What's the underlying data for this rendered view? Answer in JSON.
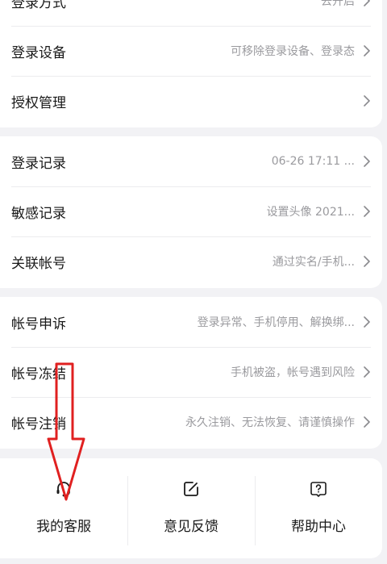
{
  "groups": {
    "top": [
      {
        "label": "登录方式",
        "value": "去开启"
      },
      {
        "label": "登录设备",
        "value": "可移除登录设备、登录态"
      },
      {
        "label": "授权管理",
        "value": ""
      }
    ],
    "mid": [
      {
        "label": "登录记录",
        "value": "06-26 17:11 ..."
      },
      {
        "label": "敏感记录",
        "value": "设置头像 2021..."
      },
      {
        "label": "关联帐号",
        "value": "通过实名/手机..."
      }
    ],
    "low": [
      {
        "label": "帐号申诉",
        "value": "登录异常、手机停用、解换绑..."
      },
      {
        "label": "帐号冻结",
        "value": "手机被盗，帐号遇到风险"
      },
      {
        "label": "帐号注销",
        "value": "永久注销、无法恢复、请谨慎操作"
      }
    ]
  },
  "shortcuts": [
    {
      "label": "我的客服",
      "icon": "headset-icon"
    },
    {
      "label": "意见反馈",
      "icon": "edit-icon"
    },
    {
      "label": "帮助中心",
      "icon": "help-icon"
    }
  ],
  "colors": {
    "background": "#f2f2f5",
    "card": "#ffffff",
    "muted_text": "#9a9a9e",
    "annotation_red": "#e02020"
  }
}
